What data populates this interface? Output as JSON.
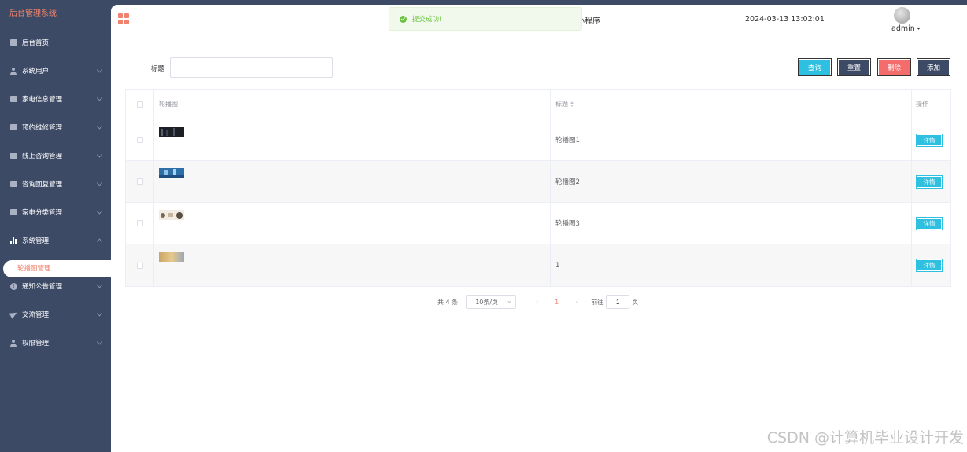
{
  "sidebar": {
    "brand": "后台管理系统",
    "items": [
      {
        "label": "后台首页",
        "icon": "monitor-icon",
        "expandable": false
      },
      {
        "label": "系统用户",
        "icon": "user-icon",
        "expandable": true
      },
      {
        "label": "家电信息管理",
        "icon": "box-icon",
        "expandable": true
      },
      {
        "label": "预约维修管理",
        "icon": "box-icon",
        "expandable": true
      },
      {
        "label": "线上咨询管理",
        "icon": "box-icon",
        "expandable": true
      },
      {
        "label": "咨询回复管理",
        "icon": "box-icon",
        "expandable": true
      },
      {
        "label": "家电分类管理",
        "icon": "box-icon",
        "expandable": true
      },
      {
        "label": "系统管理",
        "icon": "bar-chart-icon",
        "expandable": true,
        "expanded": true
      },
      {
        "label": "通知公告管理",
        "icon": "info-icon",
        "expandable": true
      },
      {
        "label": "交流管理",
        "icon": "send-icon",
        "expandable": true
      },
      {
        "label": "权限管理",
        "icon": "user-icon",
        "expandable": true
      }
    ],
    "active_sub_item": "轮播图管理"
  },
  "header": {
    "title_fragment": "小程序",
    "datetime": "2024-03-13 13:02:01",
    "user": "admin"
  },
  "toast": {
    "message": "提交成功!",
    "color": "#67c23a"
  },
  "search": {
    "label": "标题",
    "value": ""
  },
  "actions": {
    "query": "查询",
    "reset": "重置",
    "delete": "删除",
    "add": "添加"
  },
  "table": {
    "columns": {
      "image": "轮播图",
      "title": "标题",
      "operation": "操作"
    },
    "rows": [
      {
        "title": "轮播图1",
        "detail": "详情"
      },
      {
        "title": "轮播图2",
        "detail": "详情"
      },
      {
        "title": "轮播图3",
        "detail": "详情"
      },
      {
        "title": "1",
        "detail": "详情"
      }
    ]
  },
  "pagination": {
    "total": "共 4 条",
    "page_size": "10条/页",
    "current_page": "1",
    "goto_label": "前往",
    "goto_value": "1",
    "page_suffix": "页"
  },
  "watermark": "CSDN @计算机毕业设计开发",
  "colors": {
    "sidebar_bg": "#3d4a66",
    "accent": "#f0836d",
    "primary_button": "#2ec0e0",
    "danger_button": "#f56c6c"
  }
}
